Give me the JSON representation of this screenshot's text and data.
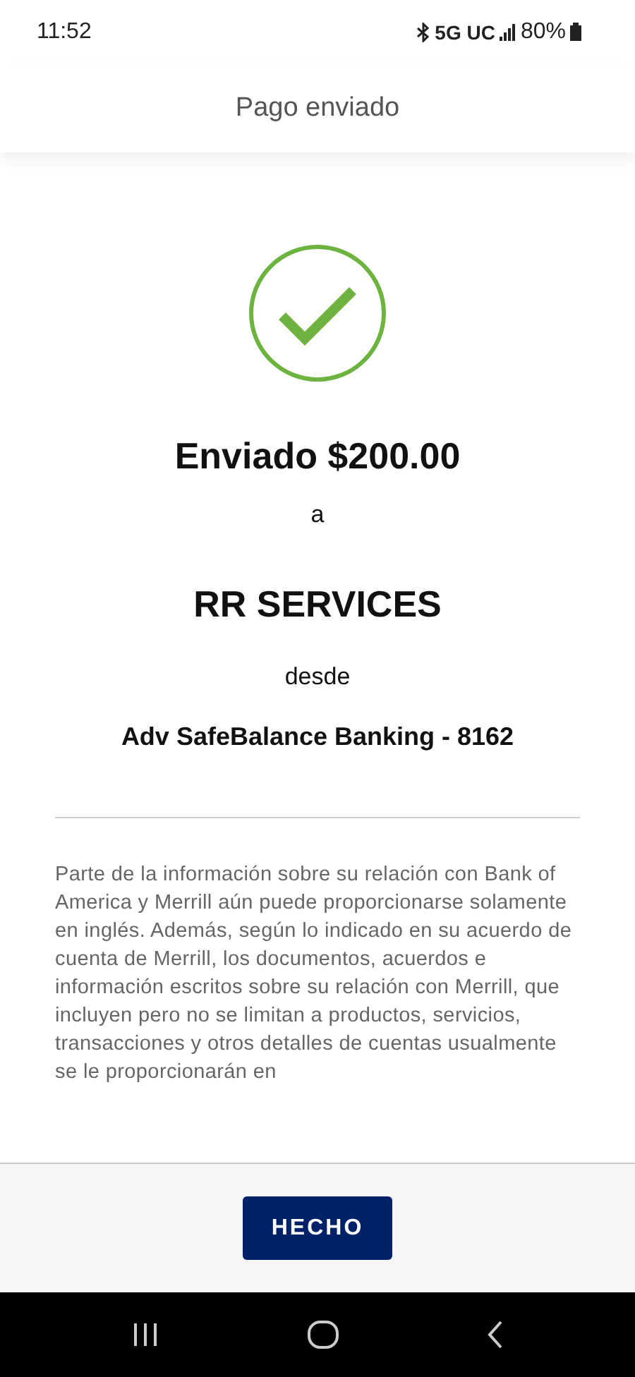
{
  "status_bar": {
    "time": "11:52",
    "network": "5G UC",
    "battery": "80%"
  },
  "header": {
    "title": "Pago enviado"
  },
  "confirmation": {
    "amount_line": "Enviado $200.00",
    "to_word": "a",
    "payee": "RR SERVICES",
    "from_word": "desde",
    "account": "Adv SafeBalance Banking - 8162"
  },
  "disclaimer": "Parte de la información sobre su relación con Bank of America y Merrill aún puede proporcionarse solamente en inglés. Además, según lo indicado en su acuerdo de cuenta de Merrill, los documentos, acuerdos e información escritos sobre su relación con Merrill, que incluyen pero no se limitan a productos, servicios, transacciones y otros detalles de cuentas usualmente se le proporcionarán en",
  "footer": {
    "button": "HECHO"
  }
}
